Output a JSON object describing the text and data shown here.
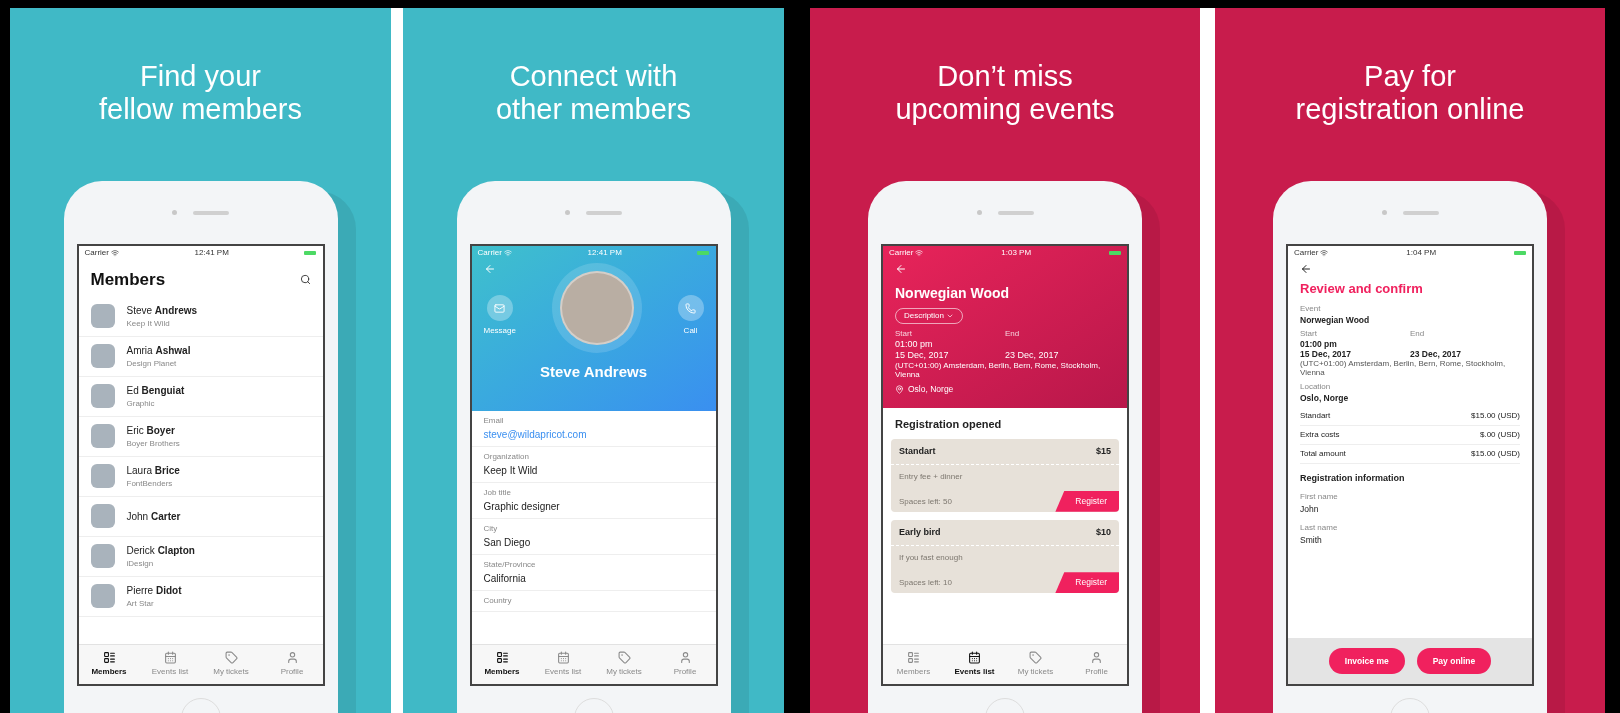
{
  "panels": [
    {
      "kind": "members",
      "color": "#40b9c6",
      "headline": [
        "Find your",
        "fellow members"
      ],
      "status": {
        "carrier": "Carrier",
        "time": "12:41 PM"
      },
      "title": "Members",
      "members": [
        {
          "name": "Steve **Andrews**",
          "subtitle": "Keep It Wild"
        },
        {
          "name": "Amria **Ashwal**",
          "subtitle": "Design Planet"
        },
        {
          "name": "Ed **Benguiat**",
          "subtitle": "Graphic"
        },
        {
          "name": "Eric **Boyer**",
          "subtitle": "Boyer Brothers"
        },
        {
          "name": "Laura **Brice**",
          "subtitle": "FontBenders"
        },
        {
          "name": "John **Carter**"
        },
        {
          "name": "Derick **Clapton**",
          "subtitle": "iDesign"
        },
        {
          "name": "Pierre **Didot**",
          "subtitle": "Art Star"
        }
      ],
      "tabs": [
        {
          "label": "Members",
          "selected": true
        },
        {
          "label": "Events list",
          "selected": false
        },
        {
          "label": "My tickets",
          "selected": false
        },
        {
          "label": "Profile",
          "selected": false
        }
      ]
    },
    {
      "kind": "profile",
      "color": "#40b9c6",
      "headline": [
        "Connect with",
        "other members"
      ],
      "status": {
        "carrier": "Carrier",
        "time": "12:41 PM"
      },
      "actions": [
        "Message",
        "Call"
      ],
      "name": "Steve Andrews",
      "fields": [
        {
          "kind": "link",
          "label": "Email",
          "value": "steve@wildapricot.com"
        },
        {
          "kind": "text",
          "label": "Organization",
          "value": "Keep It Wild"
        },
        {
          "kind": "text",
          "label": "Job title",
          "value": "Graphic designer"
        },
        {
          "kind": "text",
          "label": "City",
          "value": "San Diego"
        },
        {
          "kind": "text",
          "label": "State/Province",
          "value": "California"
        },
        {
          "label": "Country"
        }
      ],
      "tabs": [
        {
          "label": "Members",
          "selected": true
        },
        {
          "label": "Events list",
          "selected": false
        },
        {
          "label": "My tickets",
          "selected": false
        },
        {
          "label": "Profile",
          "selected": false
        }
      ]
    },
    {
      "kind": "event",
      "color": "#c81c4c",
      "headline": [
        "Don’t miss",
        "upcoming events"
      ],
      "status": {
        "carrier": "Carrier",
        "time": "1:03 PM"
      },
      "title": "Norwegian Wood",
      "description_button": "Description",
      "start_label": "Start",
      "start_time": "01:00 pm",
      "start_date": "15 Dec, 2017",
      "end_label": "End",
      "end_date": "23 Dec, 2017",
      "timezone": "(UTC+01:00) Amsterdam, Berlin, Bern, Rome, Stockholm, Vienna",
      "location": "Oslo, Norge",
      "section": "Registration opened",
      "tickets": [
        {
          "name": "Standart",
          "price": "$15",
          "description": "Entry fee + dinner",
          "spaces": "Spaces left: 50",
          "button": "Register"
        },
        {
          "name": "Early bird",
          "price": "$10",
          "description": "If you fast enough",
          "spaces": "Spaces left: 10",
          "button": "Register"
        }
      ],
      "tabs": [
        {
          "label": "Members",
          "selected": false
        },
        {
          "label": "Events list",
          "selected": true
        },
        {
          "label": "My tickets",
          "selected": false
        },
        {
          "label": "Profile",
          "selected": false
        }
      ]
    },
    {
      "kind": "review",
      "color": "#c81c4c",
      "headline": [
        "Pay for",
        "registration online"
      ],
      "status": {
        "carrier": "Carrier",
        "time": "1:04 PM"
      },
      "title": "Review and confirm",
      "event_label": "Event",
      "event": "Norwegian Wood",
      "start_label": "Start",
      "start_time": "01:00 pm",
      "start_date": "15 Dec, 2017",
      "end_label": "End",
      "end_date": "23 Dec, 2017",
      "timezone": "(UTC+01:00) Amsterdam, Berlin, Bern, Rome, Stockholm, Vienna",
      "location_label": "Location",
      "location": "Oslo, Norge",
      "lines": [
        {
          "label": "Standart",
          "amount": "$15.00 (USD)"
        },
        {
          "label": "Extra costs",
          "amount": "$.00 (USD)"
        },
        {
          "label": "Total amount",
          "amount": "$15.00 (USD)"
        }
      ],
      "section": "Registration information",
      "fields": [
        {
          "label": "First name",
          "value": "John"
        },
        {
          "label": "Last name",
          "value": "Smith"
        }
      ],
      "buttons": [
        "Invoice me",
        "Pay online"
      ]
    }
  ]
}
